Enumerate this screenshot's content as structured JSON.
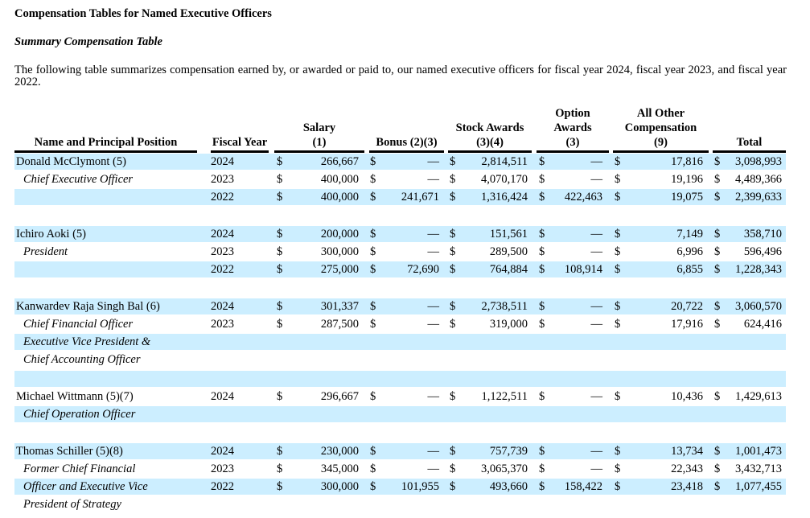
{
  "section_title": "Compensation Tables for Named Executive Officers",
  "subsection_title": "Summary Compensation Table",
  "intro_text": "The following table summarizes compensation earned by, or awarded or paid to, our named executive officers for fiscal year 2024, fiscal year 2023, and fiscal year 2022.",
  "headers": {
    "name": "Name and Principal Position",
    "year": "Fiscal Year",
    "salary_line1": "Salary",
    "salary_line2": "(1)",
    "bonus": "Bonus (2)(3)",
    "stock_line1": "Stock Awards",
    "stock_line2": "(3)(4)",
    "option_line1": "Option",
    "option_line2": "Awards",
    "option_line3": "(3)",
    "other_line1": "All Other",
    "other_line2": "Compensation",
    "other_line3": "(9)",
    "total": "Total"
  },
  "currency_symbol": "$",
  "rows": [
    {
      "shaded": true,
      "name": "Donald McClymont (5)",
      "italic": false,
      "year": "2024",
      "salary": "266,667",
      "bonus": "—",
      "stock": "2,814,511",
      "option": "—",
      "other": "17,816",
      "total": "3,098,993"
    },
    {
      "shaded": false,
      "name": "Chief Executive Officer",
      "italic": true,
      "year": "2023",
      "salary": "400,000",
      "bonus": "—",
      "stock": "4,070,170",
      "option": "—",
      "other": "19,196",
      "total": "4,489,366"
    },
    {
      "shaded": true,
      "name": "",
      "italic": false,
      "year": "2022",
      "salary": "400,000",
      "bonus": "241,671",
      "stock": "1,316,424",
      "option": "422,463",
      "other": "19,075",
      "total": "2,399,633"
    },
    {
      "shaded": false,
      "spacer": true
    },
    {
      "shaded": true,
      "name": "Ichiro Aoki (5)",
      "italic": false,
      "year": "2024",
      "salary": "200,000",
      "bonus": "—",
      "stock": "151,561",
      "option": "—",
      "other": "7,149",
      "total": "358,710"
    },
    {
      "shaded": false,
      "name": "President",
      "italic": true,
      "year": "2023",
      "salary": "300,000",
      "bonus": "—",
      "stock": "289,500",
      "option": "—",
      "other": "6,996",
      "total": "596,496"
    },
    {
      "shaded": true,
      "name": "",
      "italic": false,
      "year": "2022",
      "salary": "275,000",
      "bonus": "72,690",
      "stock": "764,884",
      "option": "108,914",
      "other": "6,855",
      "total": "1,228,343"
    },
    {
      "shaded": false,
      "spacer": true
    },
    {
      "shaded": true,
      "name": "Kanwardev Raja Singh Bal (6)",
      "italic": false,
      "year": "2024",
      "salary": "301,337",
      "bonus": "—",
      "stock": "2,738,511",
      "option": "—",
      "other": "20,722",
      "total": "3,060,570"
    },
    {
      "shaded": false,
      "name": "Chief Financial Officer",
      "italic": true,
      "year": "2023",
      "salary": "287,500",
      "bonus": "—",
      "stock": "319,000",
      "option": "—",
      "other": "17,916",
      "total": "624,416"
    },
    {
      "shaded": true,
      "name": "Executive Vice President &",
      "italic": true,
      "textonly": true
    },
    {
      "shaded": false,
      "name": "Chief Accounting Officer",
      "italic": true,
      "textonly": true
    },
    {
      "shaded": true,
      "spacer": true
    },
    {
      "shaded": false,
      "name": "Michael Wittmann (5)(7)",
      "italic": false,
      "year": "2024",
      "salary": "296,667",
      "bonus": "—",
      "stock": "1,122,511",
      "option": "—",
      "other": "10,436",
      "total": "1,429,613"
    },
    {
      "shaded": true,
      "name": "Chief Operation Officer",
      "italic": true,
      "textonly": true
    },
    {
      "shaded": false,
      "spacer": true
    },
    {
      "shaded": true,
      "name": "Thomas Schiller (5)(8)",
      "italic": false,
      "year": "2024",
      "salary": "230,000",
      "bonus": "—",
      "stock": "757,739",
      "option": "—",
      "other": "13,734",
      "total": "1,001,473"
    },
    {
      "shaded": false,
      "name": "Former Chief Financial",
      "italic": true,
      "year": "2023",
      "salary": "345,000",
      "bonus": "—",
      "stock": "3,065,370",
      "option": "—",
      "other": "22,343",
      "total": "3,432,713"
    },
    {
      "shaded": true,
      "name": "Officer and Executive Vice",
      "italic": true,
      "year": "2022",
      "salary": "300,000",
      "bonus": "101,955",
      "stock": "493,660",
      "option": "158,422",
      "other": "23,418",
      "total": "1,077,455"
    },
    {
      "shaded": false,
      "name": "President of Strategy",
      "italic": true,
      "textonly": true
    }
  ]
}
